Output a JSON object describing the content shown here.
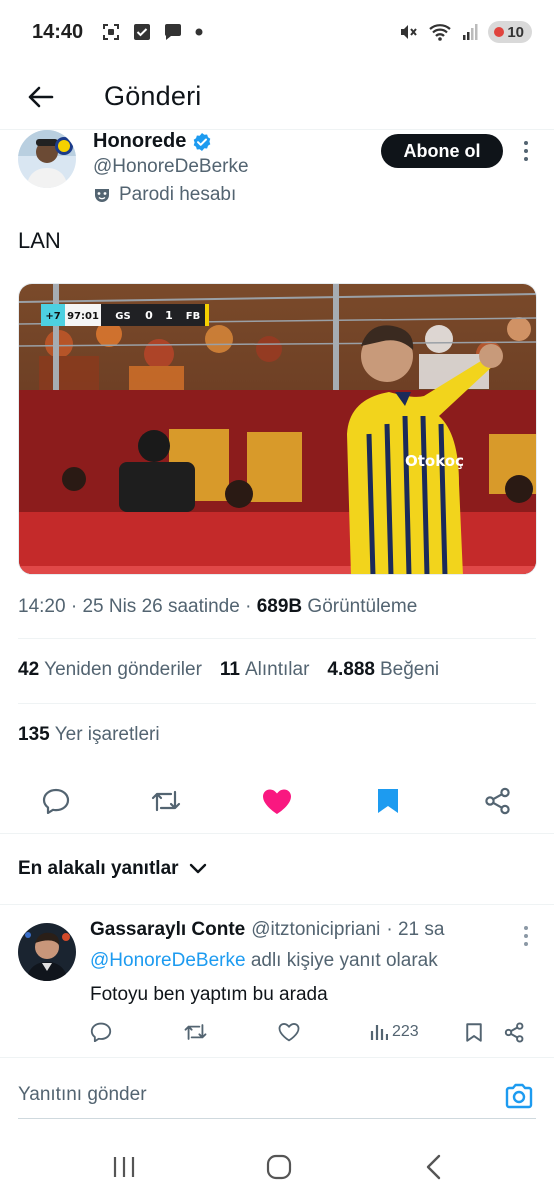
{
  "status_bar": {
    "time": "14:40",
    "battery_level": "10",
    "icons": [
      "screenshot-icon",
      "checkbox-icon",
      "chat-icon",
      "dot-icon",
      "mute-icon",
      "wifi-icon",
      "signal-icon",
      "battery-icon"
    ]
  },
  "header": {
    "title": "Gönderi",
    "back_icon": "arrow-left-icon"
  },
  "tweet": {
    "author_name": "Honorede",
    "verified_icon": "verified-badge-icon",
    "handle": "@HonoreDeBerke",
    "parody_label": "Parodi hesabı",
    "follow_label": "Abone ol",
    "text": "LAN",
    "media": {
      "scoreboard": {
        "added_time": "+7",
        "clock": "97:01",
        "home": "GS",
        "home_score": "0",
        "away_score": "1",
        "away": "FB"
      },
      "shirt_sponsor": "Otokoç"
    },
    "time": "14:20",
    "date": "25 Nis 26 saatinde",
    "views_count": "689B",
    "views_label": "Görüntüleme",
    "reposts_count": "42",
    "reposts_label": "Yeniden gönderiler",
    "quotes_count": "11",
    "quotes_label": "Alıntılar",
    "likes_count": "4.888",
    "likes_label": "Beğeni",
    "bookmarks_count": "135",
    "bookmarks_label": "Yer işaretleri",
    "liked": true,
    "bookmarked": true
  },
  "colors": {
    "accent": "#1d9bf0",
    "like": "#f91880",
    "text": "#0f1419",
    "secondary": "#536471"
  },
  "sort": {
    "label": "En alakalı yanıtlar"
  },
  "reply": {
    "name": "Gassaraylı Conte",
    "handle": "@itztonicipriani",
    "time": "· 21 sa",
    "reply_to_mention": "@HonoreDeBerke",
    "reply_to_rest": "adlı kişiye yanıt olarak",
    "text": "Fotoyu ben yaptım bu arada",
    "views": "223"
  },
  "compose": {
    "placeholder": "Yanıtını gönder"
  }
}
